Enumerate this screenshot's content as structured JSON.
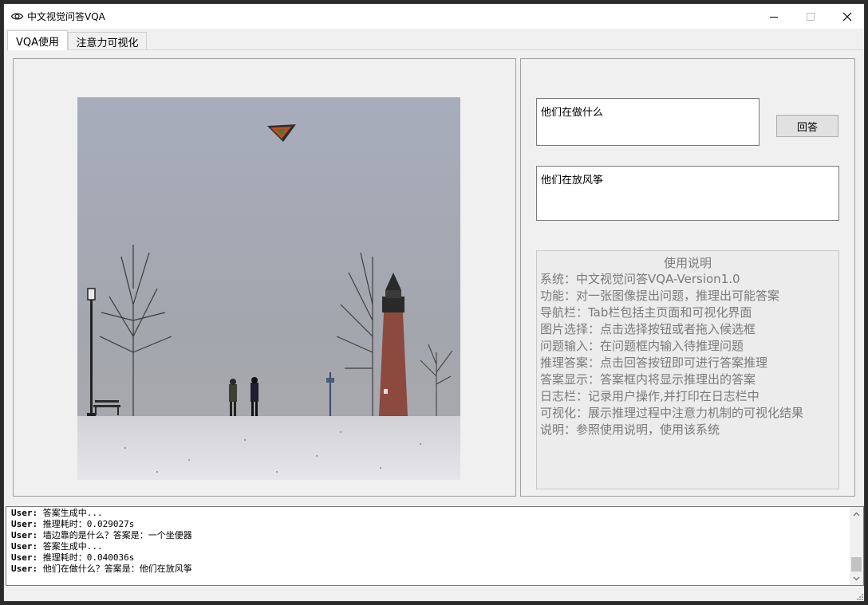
{
  "window": {
    "title": "中文视觉问答VQA",
    "icon": "eye-icon",
    "controls": [
      "minimize-icon",
      "maximize-icon",
      "close-icon"
    ]
  },
  "tabs": [
    {
      "label": "VQA使用",
      "active": true
    },
    {
      "label": "注意力可视化",
      "active": false
    }
  ],
  "image": {
    "icon": "image-preview"
  },
  "question": {
    "value": "他们在做什么"
  },
  "answer_button": {
    "label": "回答"
  },
  "answer": {
    "value": "他们在放风筝"
  },
  "instructions": {
    "title": "使用说明",
    "lines": [
      "系统：中文视觉问答VQA-Version1.0",
      "功能：对一张图像提出问题，推理出可能答案",
      "导航栏：Tab栏包括主页面和可视化界面",
      "图片选择：点击选择按钮或者拖入候选框",
      "问题输入：在问题框内输入待推理问题",
      "推理答案：点击回答按钮即可进行答案推理",
      "答案显示：答案框内将显示推理出的答案",
      "日志栏：记录用户操作,并打印在日志栏中",
      "可视化：展示推理过程中注意力机制的可视化结果",
      "说明：参照使用说明，使用该系统"
    ],
    "text_color": "#7a7a7a"
  },
  "log": {
    "entries": [
      {
        "user": "User:",
        "text": " 答案生成中..."
      },
      {
        "user": "User:",
        "text": " 推理耗时：0.029027s"
      },
      {
        "user": "User:",
        "text": " 墙边靠的是什么？答案是：一个坐便器"
      },
      {
        "user": "User:",
        "text": " 答案生成中..."
      },
      {
        "user": "User:",
        "text": " 推理耗时：0.040036s"
      },
      {
        "user": "User:",
        "text": " 他们在做什么？答案是：他们在放风筝"
      }
    ]
  }
}
